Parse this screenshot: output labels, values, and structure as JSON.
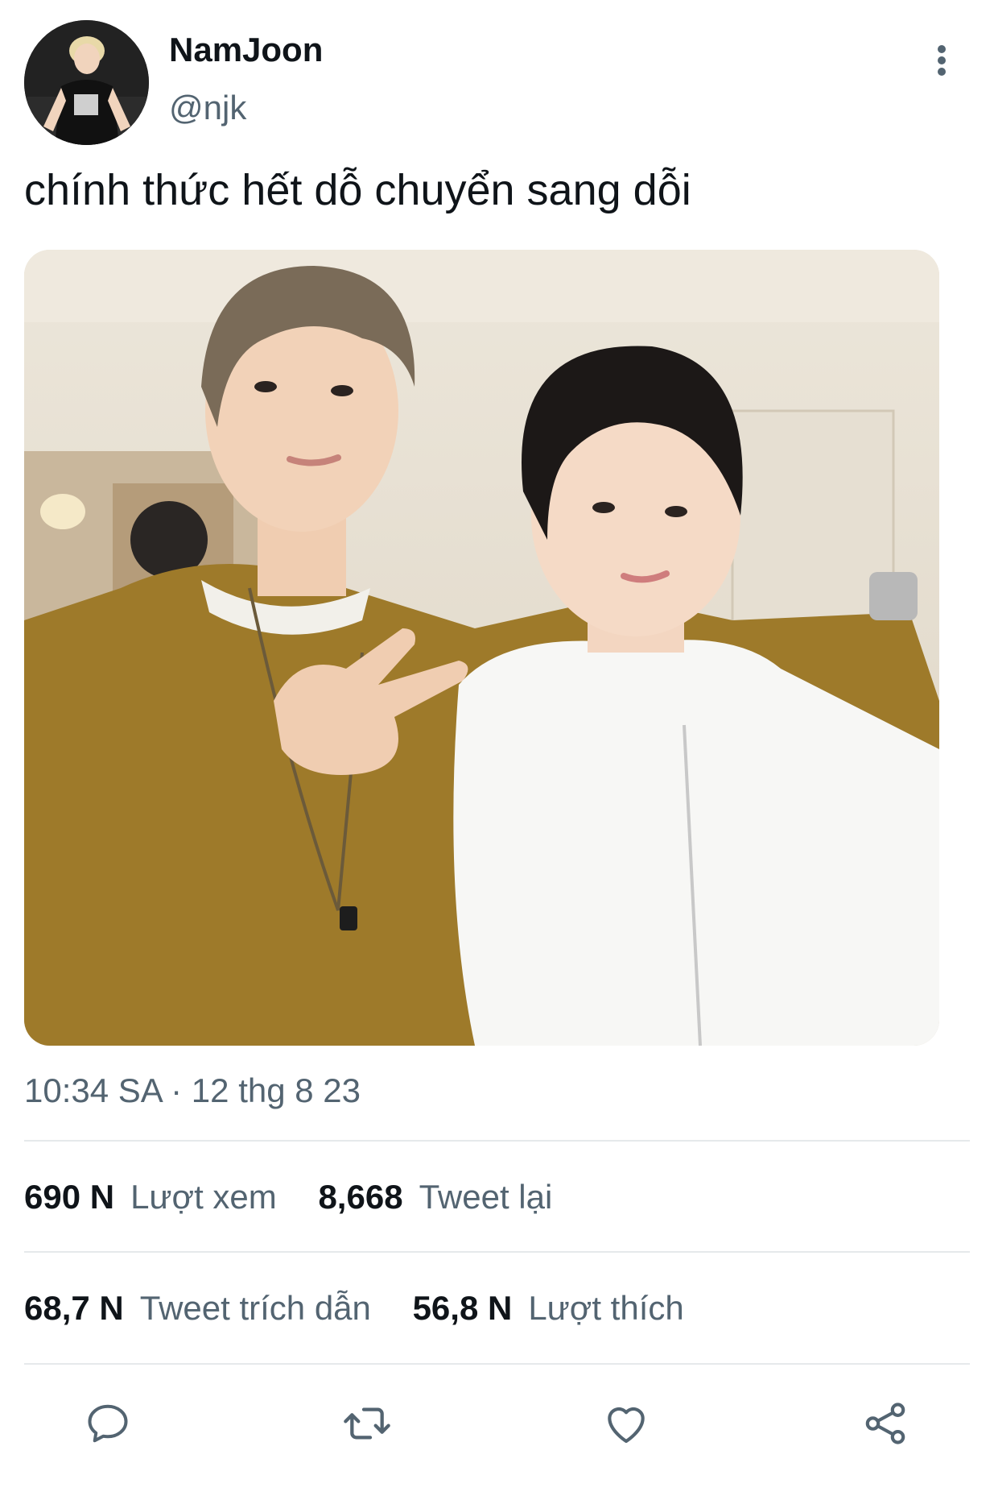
{
  "tweet": {
    "display_name": "NamJoon",
    "handle": "@njk",
    "text": "chính thức hết dỗ chuyển sang dỗi",
    "timestamp": "10:34 SA · 12 thg 8 23"
  },
  "stats": {
    "views_count": "690 N",
    "views_label": "Lượt xem",
    "retweets_count": "8,668",
    "retweets_label": "Tweet lại",
    "quotes_count": "68,7 N",
    "quotes_label": "Tweet trích dẫn",
    "likes_count": "56,8 N",
    "likes_label": "Lượt thích"
  },
  "icons": {
    "more": "more-vertical-icon",
    "reply": "reply-icon",
    "retweet": "retweet-icon",
    "like": "heart-icon",
    "share": "share-icon"
  },
  "colors": {
    "text_primary": "#0f1419",
    "text_secondary": "#536471",
    "icon": "#536471",
    "divider": "#e6e9eb"
  }
}
